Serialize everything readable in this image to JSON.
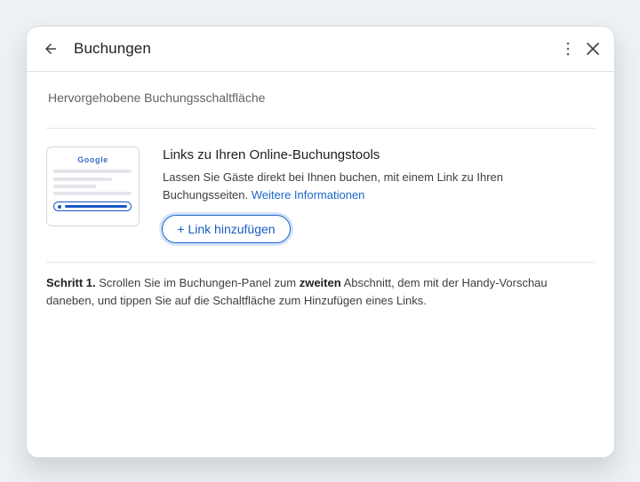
{
  "header": {
    "title": "Buchungen",
    "back_icon": "arrow-back-icon",
    "more_icon": "more-vert-icon",
    "close_icon": "close-icon"
  },
  "section": {
    "title": "Hervorgehobene Buchungsschaltfläche"
  },
  "thumbnail": {
    "logo_text": "Google"
  },
  "card": {
    "title": "Links zu Ihren Online-Buchungstools",
    "description": "Lassen Sie Gäste direkt bei Ihnen buchen, mit einem Link zu Ihren Buchungsseiten.",
    "link_text": "Weitere Informationen",
    "button_label": "+ Link hinzufügen"
  },
  "instruction": {
    "step_label": "Schritt 1.",
    "part1": "Scrollen Sie im Buchungen-Panel zum",
    "emphasis": "zweiten",
    "part2": "Abschnitt, dem mit der Handy-Vorschau daneben, und tippen Sie auf die Schaltfläche zum Hinzufügen eines Links."
  },
  "colors": {
    "accent": "#1a66c9",
    "background": "#eef1f4",
    "panel": "#ffffff"
  }
}
